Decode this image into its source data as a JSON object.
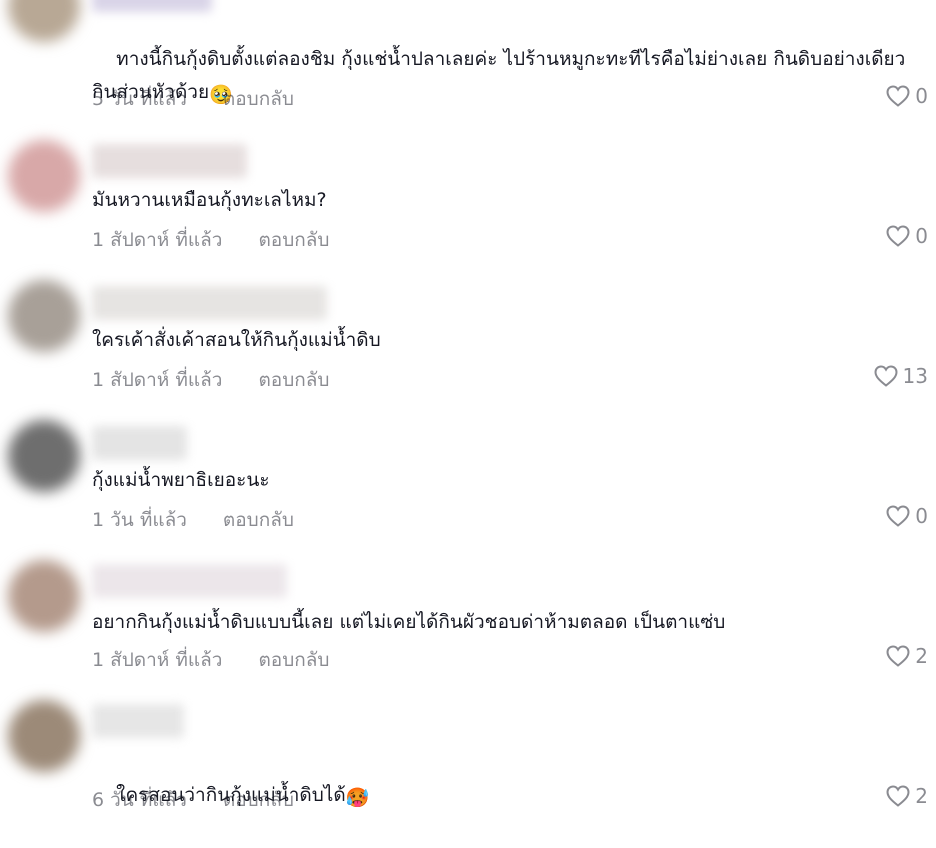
{
  "comments": [
    {
      "text": "ทางนี้กินกุ้งดิบตั้งแต่ลองชิม กุ้งแช่น้ำปลาเลยค่ะ ไปร้านหมูกะทะทีไรคือไม่ย่างเลย กินดิบอย่างเดียวกินส่วนหัวด้วย",
      "emoji": "🥹",
      "time": "5 วัน ที่แล้ว",
      "reply": "ตอบกลับ",
      "likes": "0"
    },
    {
      "text": "มันหวานเหมือนกุ้งทะเลไหม?",
      "time": "1 สัปดาห์ ที่แล้ว",
      "reply": "ตอบกลับ",
      "likes": "0"
    },
    {
      "text": "ใครเค้าสั่งเค้าสอนให้กินกุ้งแม่น้ำดิบ",
      "time": "1 สัปดาห์ ที่แล้ว",
      "reply": "ตอบกลับ",
      "likes": "13"
    },
    {
      "text": "กุ้งแม่น้ำพยาธิเยอะนะ",
      "time": "1 วัน ที่แล้ว",
      "reply": "ตอบกลับ",
      "likes": "0"
    },
    {
      "text": "อยากกินกุ้งแม่น้ำดิบแบบนี้เลย แต่ไม่เคยได้กินผัวชอบด่าห้ามตลอด เป็นตาแซ่บ",
      "time": "1 สัปดาห์ ที่แล้ว",
      "reply": "ตอบกลับ",
      "likes": "2"
    },
    {
      "text": "ใครสอนว่ากินกุ้งแม่น้ำดิบได้",
      "emoji": "🥵",
      "time": "6 วัน ที่แล้ว",
      "reply": "ตอบกลับ",
      "likes": "2"
    }
  ],
  "colors": {
    "text": "#161823",
    "muted": "#8a8b91",
    "background": "#ffffff"
  },
  "icons": {
    "like": "heart-outline-icon"
  }
}
